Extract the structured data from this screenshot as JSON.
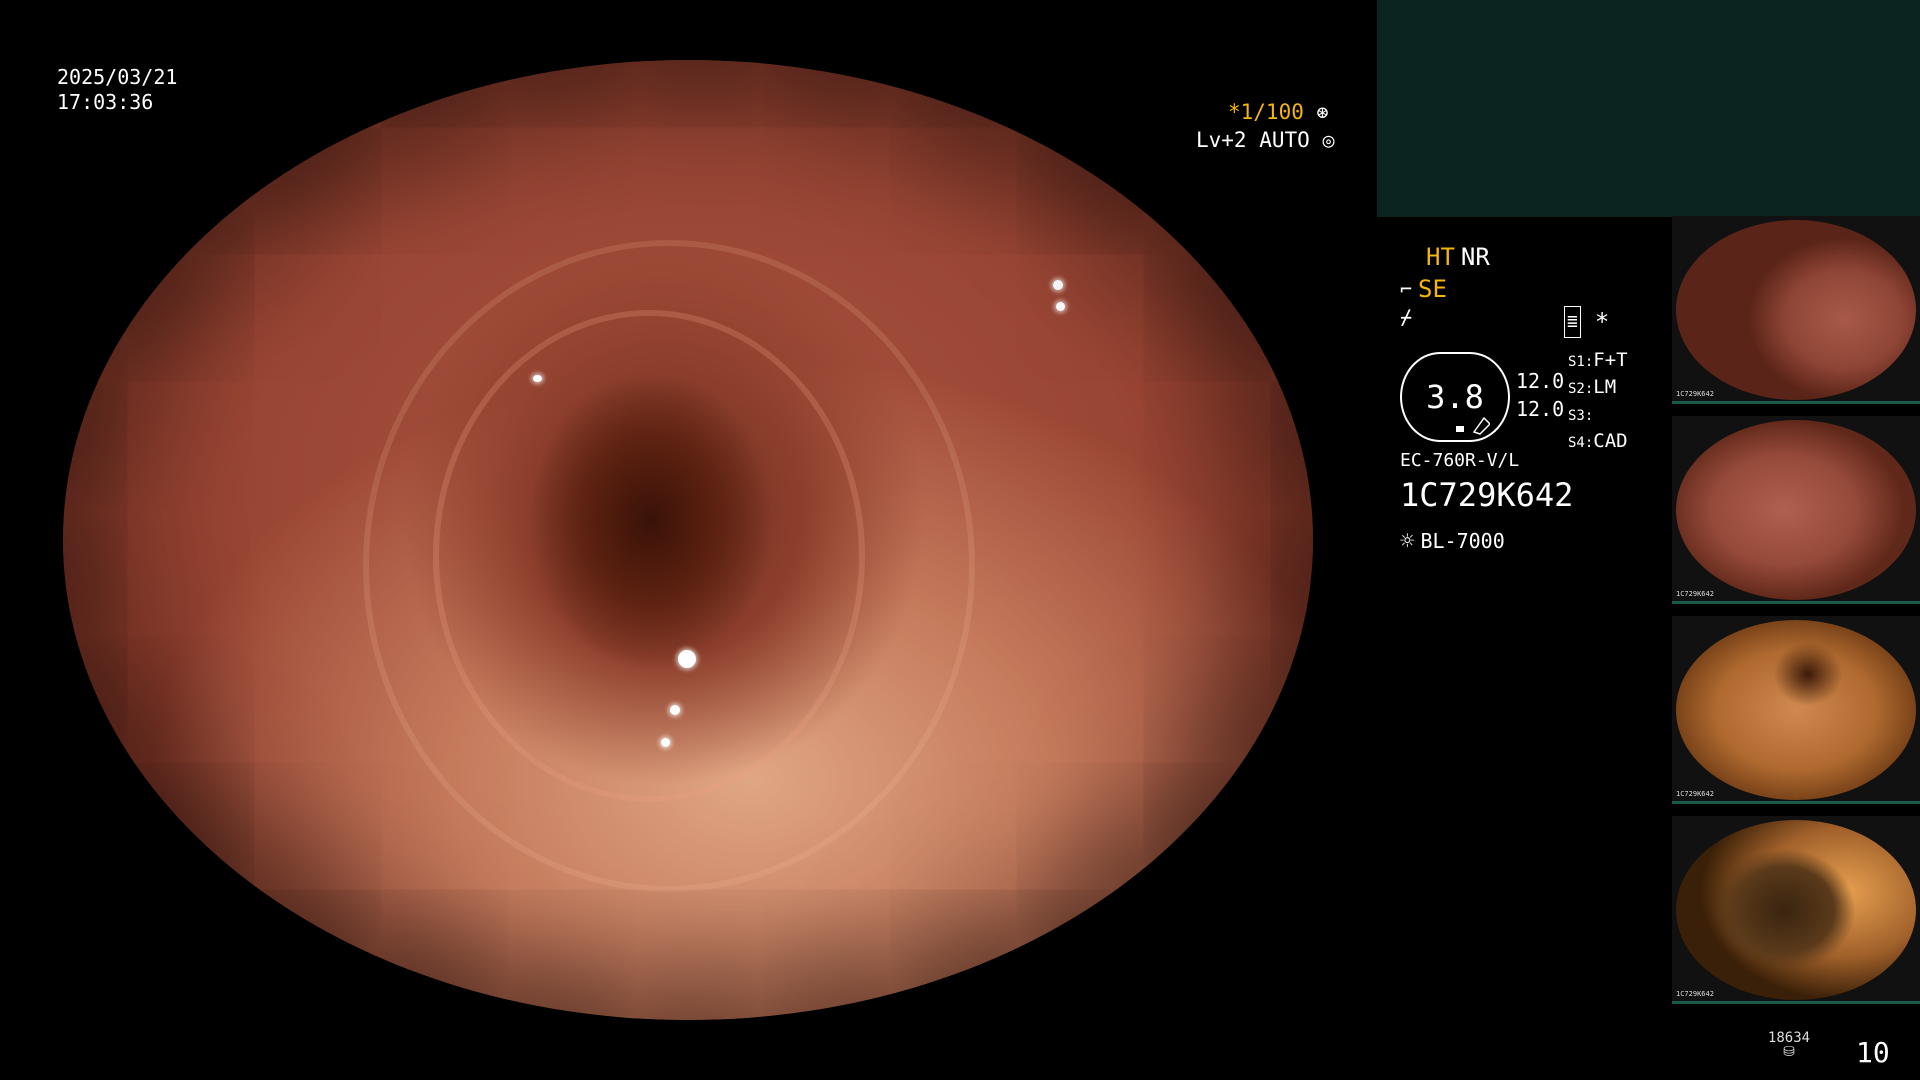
{
  "overlay": {
    "date": "2025/03/21",
    "time": "17:03:36",
    "shutter": "*1/100",
    "level": "Lv+2 AUTO"
  },
  "panel": {
    "ht": "HT",
    "nr": "NR",
    "se": "SE",
    "zoom": "3.8",
    "val_top": "12.0",
    "val_bottom": "12.0",
    "s1_key": "S1:",
    "s1": "F+T",
    "s2_key": "S2:",
    "s2": "LM",
    "s3_key": "S3:",
    "s3": "",
    "s4_key": "S4:",
    "s4": "CAD",
    "scope_model": "EC-760R-V/L",
    "serial": "1C729K642",
    "light_source": "BL-7000",
    "asterisk": "*"
  },
  "thumbnails": [
    {
      "caption": "1C729K642"
    },
    {
      "caption": "1C729K642"
    },
    {
      "caption": "1C729K642"
    },
    {
      "caption": "1C729K642"
    }
  ],
  "footer": {
    "counter": "18634",
    "count": "10"
  },
  "colors": {
    "accent_yellow": "#f5b50d",
    "panel_teal": "#0c2420"
  }
}
